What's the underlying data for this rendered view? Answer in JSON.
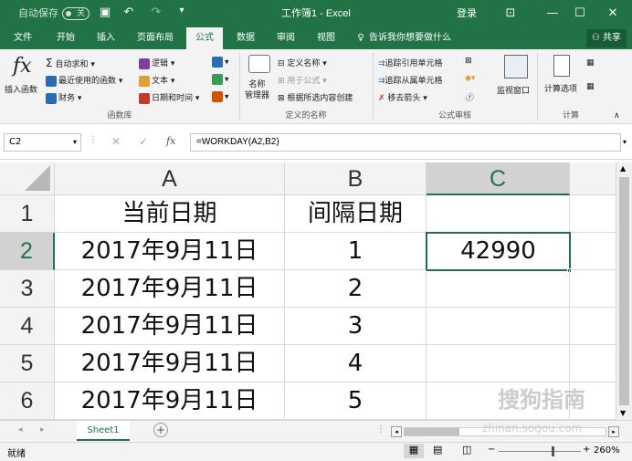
{
  "titlebar": {
    "autosave_label": "自动保存",
    "autosave_state": "关",
    "title": "工作簿1 - Excel",
    "login": "登录"
  },
  "tabs": [
    "文件",
    "开始",
    "插入",
    "页面布局",
    "公式",
    "数据",
    "审阅",
    "视图"
  ],
  "active_tab": "公式",
  "tell_me": "告诉我你想要做什么",
  "share": "共享",
  "ribbon": {
    "insert_function": "插入函数",
    "autosum": "自动求和",
    "recent": "最近使用的函数",
    "financial": "财务",
    "logical": "逻辑",
    "text": "文本",
    "datetime": "日期和时间",
    "group_library": "函数库",
    "name_manager": "名称\n管理器",
    "define_name": "定义名称",
    "use_in_formula": "用于公式",
    "create_from_selection": "根据所选内容创建",
    "group_names": "定义的名称",
    "trace_precedents": "追踪引用单元格",
    "trace_dependents": "追踪从属单元格",
    "remove_arrows": "移去箭头",
    "watch_window": "监视窗口",
    "group_audit": "公式审核",
    "calc_options": "计算选项",
    "group_calc": "计算"
  },
  "formula_bar": {
    "name_box": "C2",
    "formula": "=WORKDAY(A2,B2)"
  },
  "grid": {
    "columns": [
      "A",
      "B",
      "C"
    ],
    "rows": [
      "1",
      "2",
      "3",
      "4",
      "5",
      "6"
    ],
    "cells": [
      [
        "当前日期",
        "间隔日期",
        ""
      ],
      [
        "2017年9月11日",
        "1",
        "42990"
      ],
      [
        "2017年9月11日",
        "2",
        ""
      ],
      [
        "2017年9月11日",
        "3",
        ""
      ],
      [
        "2017年9月11日",
        "4",
        ""
      ],
      [
        "2017年9月11日",
        "5",
        ""
      ]
    ]
  },
  "sheet_tab": "Sheet1",
  "status": {
    "ready": "就绪",
    "zoom": "260%"
  },
  "watermark": "搜狗指南",
  "watermark_url": "zhinan.sogou.com",
  "colors": {
    "excel_green": "#217346",
    "ribbon_bg": "#f3f3f3"
  }
}
